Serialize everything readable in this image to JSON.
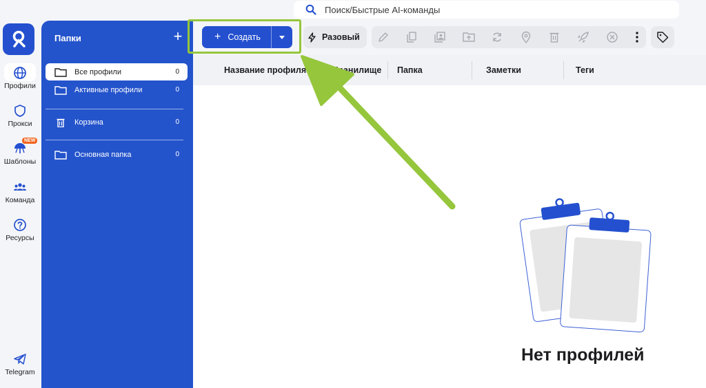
{
  "search": {
    "placeholder": "Поиск/Быстрые AI-команды"
  },
  "rail": {
    "items": [
      {
        "label": "Профили",
        "icon": "globe-icon"
      },
      {
        "label": "Прокси",
        "icon": "shield-icon"
      },
      {
        "label": "Шаблоны",
        "icon": "umbrella-icon",
        "badge": "NEW"
      },
      {
        "label": "Команда",
        "icon": "team-icon"
      },
      {
        "label": "Ресурсы",
        "icon": "question-icon"
      },
      {
        "label": "Telegram",
        "icon": "telegram-icon"
      }
    ]
  },
  "folders": {
    "title": "Папки",
    "add_label": "+",
    "items": [
      {
        "label": "Все профили",
        "count": "0"
      },
      {
        "label": "Активные профили",
        "count": "0"
      },
      {
        "label": "Корзина",
        "count": "0"
      },
      {
        "label": "Основная папка",
        "count": "0"
      }
    ]
  },
  "toolbar": {
    "create_label": "Создать",
    "once_label": "Разовый",
    "tools": [
      "edit-icon",
      "copy-icon",
      "clone-icon",
      "move-folder-icon",
      "refresh-icon",
      "location-icon",
      "trash-icon",
      "rocket-icon",
      "stop-icon",
      "more-icon"
    ]
  },
  "table": {
    "columns": [
      "Название профиля",
      "Хранилище",
      "Папка",
      "Заметки",
      "Теги"
    ]
  },
  "empty": {
    "title": "Нет профилей"
  },
  "colors": {
    "brand": "#2450cf",
    "sidebar": "#2454cc",
    "highlight": "#95c63c",
    "badge": "#f2661f"
  }
}
